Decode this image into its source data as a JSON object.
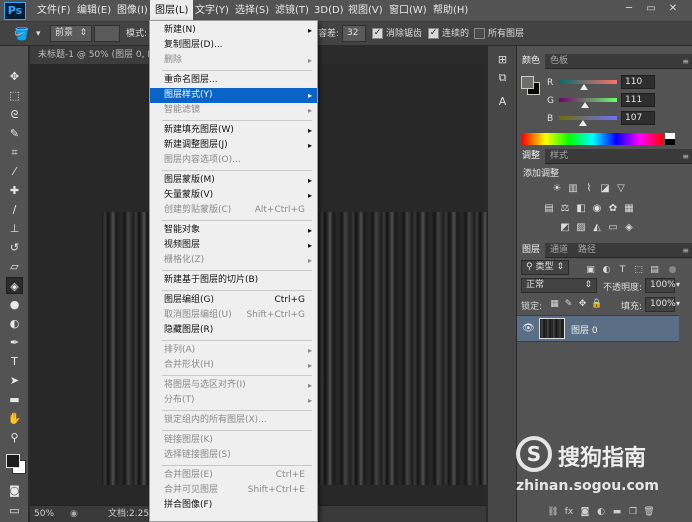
{
  "menubar": {
    "logo": "Ps",
    "items": [
      "文件(F)",
      "编辑(E)",
      "图像(I)",
      "图层(L)",
      "文字(Y)",
      "选择(S)",
      "滤镜(T)",
      "3D(D)",
      "视图(V)",
      "窗口(W)",
      "帮助(H)"
    ],
    "active_item": "图层(L)",
    "window_controls": [
      "minimize-icon",
      "restore-icon",
      "close-icon"
    ]
  },
  "options_bar": {
    "tool_icon": "paint-bucket-icon",
    "fill_source": "前景",
    "mode_label": "模式:",
    "tolerance_label": "容差:",
    "tolerance_value": "32",
    "antialias_label": "消除锯齿",
    "antialias_checked": true,
    "contiguous_label": "连续的",
    "contiguous_checked": true,
    "all_layers_label": "所有图层",
    "all_layers_checked": false
  },
  "document": {
    "tab_title": "未标题-1 @ 50% (图层 0, RGB/8)",
    "zoom": "50%",
    "doc_info": "文档:2.25M"
  },
  "toolbar": {
    "tools": [
      "move-icon",
      "marquee-icon",
      "lasso-icon",
      "quick-select-icon",
      "crop-icon",
      "eyedropper-icon",
      "healing-brush-icon",
      "brush-icon",
      "clone-stamp-icon",
      "history-brush-icon",
      "eraser-icon",
      "paint-bucket-icon",
      "blur-icon",
      "dodge-icon",
      "pen-icon",
      "type-icon",
      "path-select-icon",
      "rectangle-icon",
      "hand-icon",
      "zoom-icon"
    ],
    "selected_tool": "paint-bucket-icon",
    "foreground_color": "#1b1b1b",
    "background_color": "#ffffff"
  },
  "layer_menu": {
    "items": [
      {
        "label": "新建(N)",
        "submenu": true,
        "disabled": false
      },
      {
        "label": "复制图层(D)...",
        "disabled": false
      },
      {
        "label": "删除",
        "submenu": true,
        "disabled": true
      },
      {
        "label": "重命名图层...",
        "disabled": false,
        "sep_before": true
      },
      {
        "label": "图层样式(Y)",
        "submenu": true,
        "disabled": false,
        "highlighted": true
      },
      {
        "label": "智能滤镜",
        "submenu": true,
        "disabled": true
      },
      {
        "label": "新建填充图层(W)",
        "submenu": true,
        "disabled": false,
        "sep_before": true
      },
      {
        "label": "新建调整图层(J)",
        "submenu": true,
        "disabled": false
      },
      {
        "label": "图层内容选项(O)...",
        "disabled": true
      },
      {
        "label": "图层蒙版(M)",
        "submenu": true,
        "disabled": false,
        "sep_before": true
      },
      {
        "label": "矢量蒙版(V)",
        "submenu": true,
        "disabled": false
      },
      {
        "label": "创建剪贴蒙版(C)",
        "shortcut": "Alt+Ctrl+G",
        "disabled": true
      },
      {
        "label": "智能对象",
        "submenu": true,
        "disabled": false,
        "sep_before": true
      },
      {
        "label": "视频图层",
        "submenu": true,
        "disabled": false
      },
      {
        "label": "栅格化(Z)",
        "submenu": true,
        "disabled": true
      },
      {
        "label": "新建基于图层的切片(B)",
        "disabled": false,
        "sep_before": true
      },
      {
        "label": "图层编组(G)",
        "shortcut": "Ctrl+G",
        "disabled": false,
        "sep_before": true
      },
      {
        "label": "取消图层编组(U)",
        "shortcut": "Shift+Ctrl+G",
        "disabled": true
      },
      {
        "label": "隐藏图层(R)",
        "disabled": false
      },
      {
        "label": "排列(A)",
        "submenu": true,
        "disabled": true,
        "sep_before": true
      },
      {
        "label": "合并形状(H)",
        "submenu": true,
        "disabled": true
      },
      {
        "label": "将图层与选区对齐(I)",
        "submenu": true,
        "disabled": true,
        "sep_before": true
      },
      {
        "label": "分布(T)",
        "submenu": true,
        "disabled": true
      },
      {
        "label": "锁定组内的所有图层(X)...",
        "disabled": true,
        "sep_before": true
      },
      {
        "label": "链接图层(K)",
        "disabled": true,
        "sep_before": true
      },
      {
        "label": "选择链接图层(S)",
        "disabled": true
      },
      {
        "label": "合并图层(E)",
        "shortcut": "Ctrl+E",
        "disabled": true,
        "sep_before": true
      },
      {
        "label": "合并可见图层",
        "shortcut": "Shift+Ctrl+E",
        "disabled": true
      },
      {
        "label": "拼合图像(F)",
        "disabled": false
      }
    ]
  },
  "color_panel": {
    "tabs": [
      "颜色",
      "色板"
    ],
    "channels": [
      {
        "label": "R",
        "value": "110",
        "fraction": 0.43
      },
      {
        "label": "G",
        "value": "111",
        "fraction": 0.44
      },
      {
        "label": "B",
        "value": "107",
        "fraction": 0.42
      }
    ]
  },
  "adjustments_panel": {
    "tabs": [
      "调整",
      "样式"
    ],
    "heading": "添加调整",
    "icons": [
      "brightness-icon",
      "levels-icon",
      "curves-icon",
      "exposure-icon",
      "vibrance-icon",
      "hue-saturation-icon",
      "color-balance-icon",
      "black-white-icon",
      "photo-filter-icon",
      "channel-mixer-icon",
      "color-lookup-icon",
      "invert-icon",
      "posterize-icon",
      "threshold-icon",
      "gradient-map-icon",
      "selective-color-icon"
    ]
  },
  "layers_panel": {
    "tabs": [
      "图层",
      "通道",
      "路径"
    ],
    "filter_kind": "类型",
    "blend_mode": "正常",
    "opacity_label": "不透明度:",
    "opacity_value": "100%",
    "lock_label": "锁定:",
    "fill_label": "填充:",
    "fill_value": "100%",
    "layers": [
      {
        "name": "图层 0",
        "visible": true
      }
    ],
    "footer_icons": [
      "link-icon",
      "fx-icon",
      "mask-icon",
      "adjustment-icon",
      "folder-icon",
      "new-layer-icon",
      "trash-icon"
    ]
  },
  "watermark": {
    "logo_letter": "S",
    "brand": "搜狗指南",
    "url": "zhinan.sogou.com"
  }
}
